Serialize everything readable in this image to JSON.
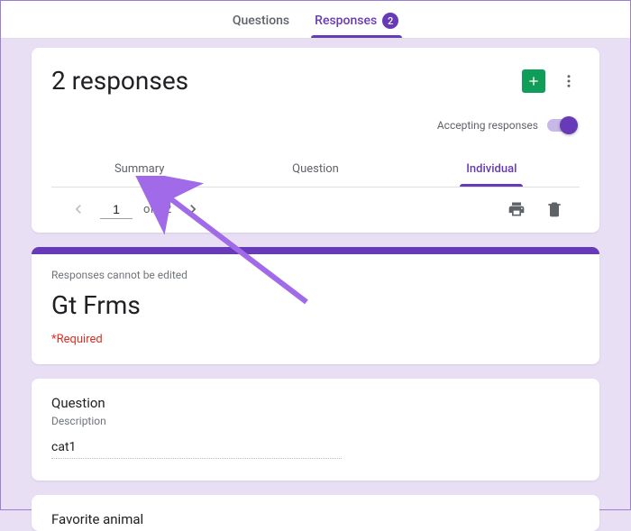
{
  "topbar": {
    "tab_questions": "Questions",
    "tab_responses": "Responses",
    "response_count": "2"
  },
  "responses": {
    "count_title": "2 responses",
    "accepting_label": "Accepting responses",
    "accepting_on": true,
    "subtabs": {
      "summary": "Summary",
      "question": "Question",
      "individual": "Individual"
    },
    "page_current": "1",
    "page_of_label": "of",
    "page_total": "2"
  },
  "form": {
    "noedit": "Responses cannot be edited",
    "title": "Gt Frms",
    "required": "*Required"
  },
  "question1": {
    "title": "Question",
    "desc": "Description",
    "answer": "cat1"
  },
  "question2": {
    "title": "Favorite animal"
  },
  "icons": {
    "sheets": "sheets-icon",
    "kebab": "kebab-icon",
    "print": "print-icon",
    "delete": "delete-icon",
    "chev_left": "chevron-left-icon",
    "chev_right": "chevron-right-icon"
  }
}
